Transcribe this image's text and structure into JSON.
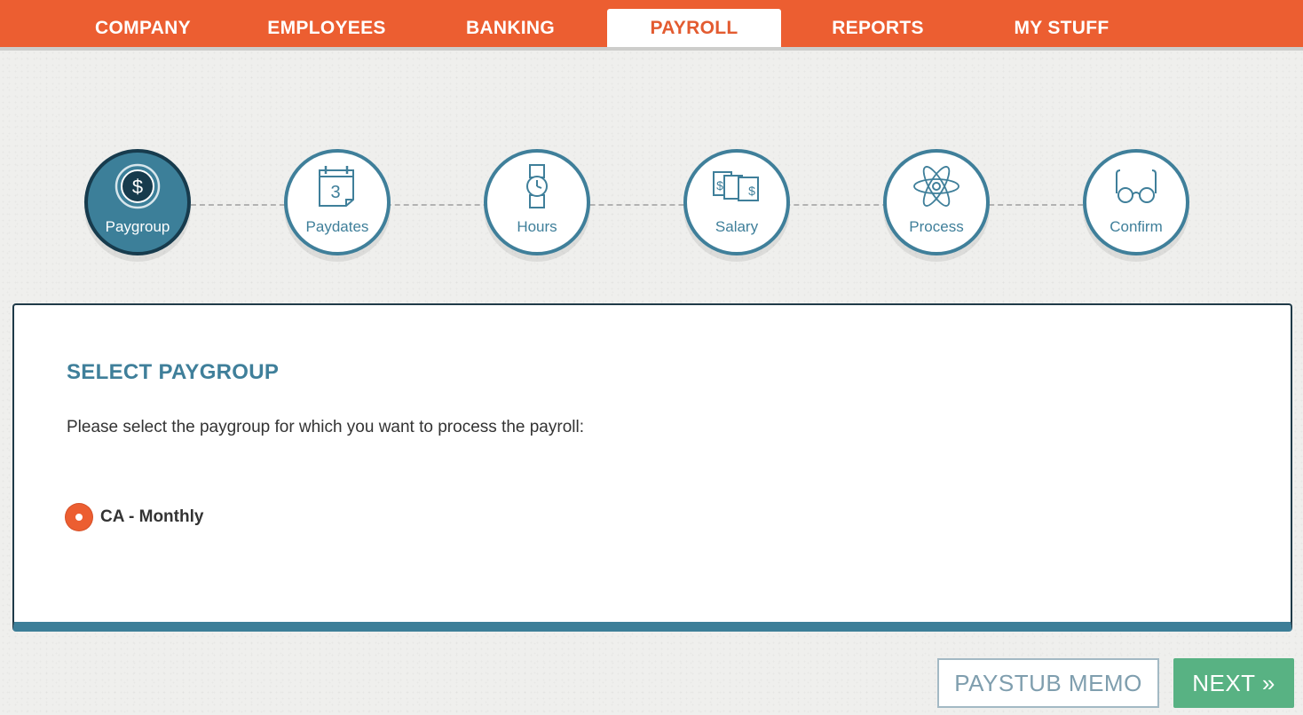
{
  "nav": {
    "tabs": [
      {
        "label": "COMPANY"
      },
      {
        "label": "EMPLOYEES"
      },
      {
        "label": "BANKING"
      },
      {
        "label": "PAYROLL",
        "active": true
      },
      {
        "label": "REPORTS"
      },
      {
        "label": "MY STUFF"
      }
    ]
  },
  "stepper": {
    "steps": [
      {
        "label": "Paygroup",
        "icon": "dollar-coin-icon",
        "active": true
      },
      {
        "label": "Paydates",
        "icon": "calendar-icon",
        "icon_text": "3"
      },
      {
        "label": "Hours",
        "icon": "wristwatch-icon"
      },
      {
        "label": "Salary",
        "icon": "money-bills-icon",
        "icon_text": "$"
      },
      {
        "label": "Process",
        "icon": "atom-icon"
      },
      {
        "label": "Confirm",
        "icon": "eyeglasses-icon"
      }
    ]
  },
  "panel": {
    "title": "SELECT PAYGROUP",
    "description": "Please select the paygroup for which you want to process the payroll:",
    "option": {
      "label": "CA - Monthly",
      "selected": true
    }
  },
  "buttons": {
    "memo_label": "PAYSTUB MEMO",
    "next_label": "NEXT »"
  },
  "colors": {
    "brand_orange": "#ec5e31",
    "teal": "#3f7f9a",
    "next_green": "#58b283"
  }
}
